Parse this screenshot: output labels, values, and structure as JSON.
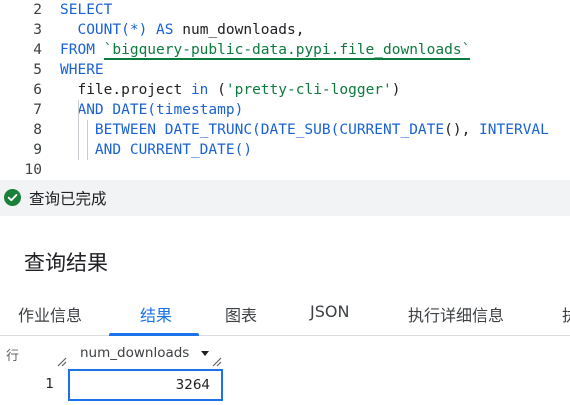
{
  "editor": {
    "lines": [
      {
        "num": "2",
        "tokens": [
          {
            "t": "SELECT",
            "c": "kw"
          }
        ]
      },
      {
        "num": "3",
        "tokens": [
          {
            "t": "  "
          },
          {
            "t": "COUNT(*) AS",
            "c": "kw"
          },
          {
            "t": " num_downloads,"
          }
        ]
      },
      {
        "num": "4",
        "tokens": [
          {
            "t": "FROM",
            "c": "kw"
          },
          {
            "t": " "
          },
          {
            "t": "`bigquery-public-data.pypi.file_downloads`",
            "c": "str ul"
          }
        ]
      },
      {
        "num": "5",
        "tokens": [
          {
            "t": "WHERE",
            "c": "kw"
          }
        ]
      },
      {
        "num": "6",
        "tokens": [
          {
            "t": "  file.project "
          },
          {
            "t": "in",
            "c": "kw"
          },
          {
            "t": " ("
          },
          {
            "t": "'pretty-cli-logger'",
            "c": "str"
          },
          {
            "t": ")"
          }
        ]
      },
      {
        "num": "7",
        "tokens": [
          {
            "t": "  "
          },
          {
            "t": "AND DATE(timestamp)",
            "c": "kw"
          }
        ]
      },
      {
        "num": "8",
        "tokens": [
          {
            "t": "    "
          },
          {
            "t": "BETWEEN DATE_TRUNC(DATE_SUB(CURRENT_DATE",
            "c": "kw"
          },
          {
            "t": "(), "
          },
          {
            "t": "INTERVAL",
            "c": "kw"
          }
        ]
      },
      {
        "num": "9",
        "tokens": [
          {
            "t": "    "
          },
          {
            "t": "AND CURRENT_DATE",
            "c": "kw"
          },
          {
            "t": "()",
            "c": "kw"
          }
        ]
      },
      {
        "num": "10",
        "tokens": []
      }
    ]
  },
  "status": {
    "icon": "check-circle-icon",
    "color": "#188038",
    "text": "查询已完成"
  },
  "results": {
    "title": "查询结果",
    "tabs": [
      {
        "label": "作业信息",
        "active": false
      },
      {
        "label": "结果",
        "active": true
      },
      {
        "label": "图表",
        "active": false
      },
      {
        "label": "JSON",
        "active": false
      },
      {
        "label": "执行详细信息",
        "active": false
      },
      {
        "label": "执",
        "active": false
      }
    ],
    "accent": "#1a73e8",
    "table": {
      "row_label": "行",
      "columns": [
        "num_downloads"
      ],
      "rows": [
        {
          "num": "1",
          "values": [
            "3264"
          ]
        }
      ]
    }
  }
}
